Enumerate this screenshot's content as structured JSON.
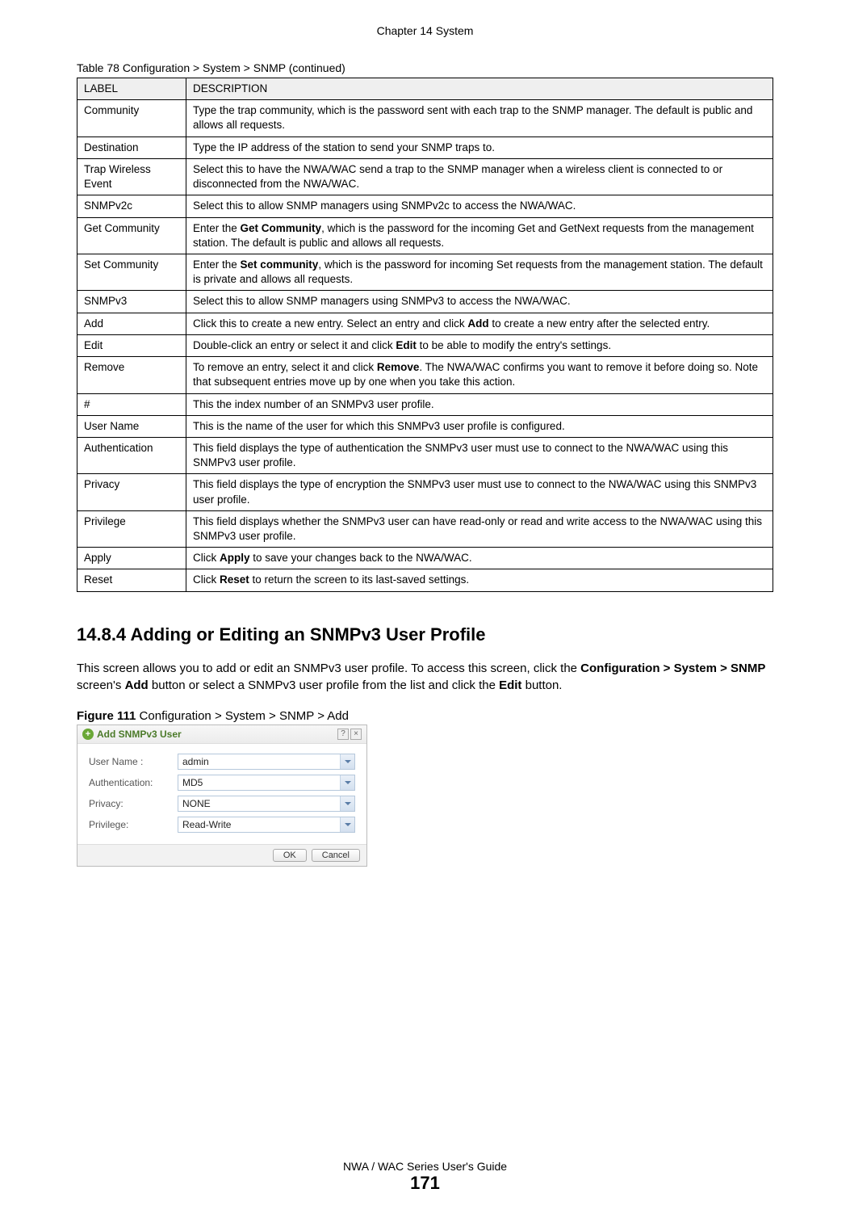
{
  "chapter_header": "Chapter 14 System",
  "table_caption_prefix": "Table 78   ",
  "table_caption_text": "Configuration > System > SNMP (continued)",
  "table": {
    "header_label": "LABEL",
    "header_desc": "DESCRIPTION",
    "rows": [
      {
        "label": "Community",
        "desc": "Type the trap community, which is the password sent with each trap to the SNMP manager. The default is public and allows all requests."
      },
      {
        "label": "Destination",
        "desc": "Type the IP address of the station to send your SNMP traps to."
      },
      {
        "label": "Trap Wireless Event",
        "desc": "Select this to have the NWA/WAC send a trap to the SNMP manager when a wireless client is connected to or disconnected from the NWA/WAC."
      },
      {
        "label": "SNMPv2c",
        "desc": "Select this to allow SNMP managers using SNMPv2c to access the NWA/WAC."
      },
      {
        "label": "Get Community",
        "desc_parts": [
          "Enter the ",
          "Get Community",
          ", which is the password for the incoming Get and GetNext requests from the management station. The default is public and allows all requests."
        ]
      },
      {
        "label": "Set Community",
        "desc_parts": [
          "Enter the ",
          "Set community",
          ", which is the password for incoming Set requests from the management station. The default is private and allows all requests."
        ]
      },
      {
        "label": "SNMPv3",
        "desc": "Select this to allow SNMP managers using SNMPv3 to access the NWA/WAC."
      },
      {
        "label": "Add",
        "desc_parts": [
          "Click this to create a new entry. Select an entry and click ",
          "Add",
          " to create a new entry after the selected entry."
        ]
      },
      {
        "label": "Edit",
        "desc_parts": [
          "Double-click an entry or select it and click ",
          "Edit",
          " to be able to modify the entry's settings."
        ]
      },
      {
        "label": "Remove",
        "desc_parts": [
          "To remove an entry, select it and click ",
          "Remove",
          ". The NWA/WAC confirms you want to remove it before doing so. Note that subsequent entries move up by one when you take this action."
        ]
      },
      {
        "label": "#",
        "desc": "This the index number of an SNMPv3 user profile."
      },
      {
        "label": "User Name",
        "desc": "This is the name of the user for which this SNMPv3 user profile is configured."
      },
      {
        "label": "Authentication",
        "desc": "This field displays the type of authentication the SNMPv3 user must use to connect to the NWA/WAC using this SNMPv3 user profile."
      },
      {
        "label": "Privacy",
        "desc": "This field displays the type of encryption the SNMPv3 user must use to connect to the NWA/WAC using this SNMPv3 user profile."
      },
      {
        "label": "Privilege",
        "desc": "This field displays whether the SNMPv3 user can have read-only or read and write access to the NWA/WAC using this SNMPv3 user profile."
      },
      {
        "label": "Apply",
        "desc_parts": [
          "Click ",
          "Apply",
          " to save your changes back to the NWA/WAC."
        ]
      },
      {
        "label": "Reset",
        "desc_parts": [
          "Click ",
          "Reset",
          " to return the screen to its last-saved settings."
        ]
      }
    ]
  },
  "section_heading": "14.8.4  Adding or Editing an SNMPv3 User Profile",
  "body": {
    "p1_a": "This screen allows you to add or edit an SNMPv3 user profile. To access this screen, click the ",
    "p1_b": "Configuration > System > SNMP",
    "p1_c": " screen's ",
    "p1_d": "Add",
    "p1_e": " button or select a SNMPv3 user profile from the list and click the ",
    "p1_f": "Edit",
    "p1_g": " button."
  },
  "figure_caption_prefix": "Figure 111   ",
  "figure_caption_text": "Configuration > System > SNMP > Add",
  "dialog": {
    "title": "Add SNMPv3 User",
    "add_icon_glyph": "+",
    "help_glyph": "?",
    "close_glyph": "×",
    "fields": {
      "user_name_label": "User Name :",
      "user_name_value": "admin",
      "auth_label": "Authentication:",
      "auth_value": "MD5",
      "privacy_label": "Privacy:",
      "privacy_value": "NONE",
      "privilege_label": "Privilege:",
      "privilege_value": "Read-Write"
    },
    "ok_label": "OK",
    "cancel_label": "Cancel"
  },
  "footer_text": "NWA / WAC Series User's Guide",
  "page_number": "171"
}
